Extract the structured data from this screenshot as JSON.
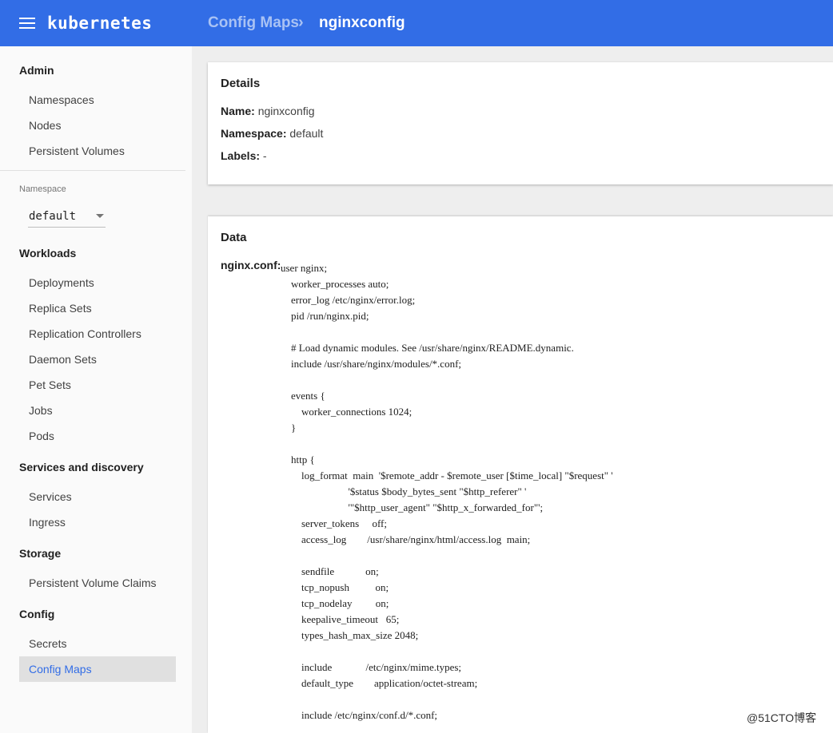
{
  "header": {
    "brand": "kubernetes",
    "breadcrumb_parent": "Config Maps",
    "breadcrumb_separator": "›",
    "breadcrumb_current": "nginxconfig"
  },
  "sidebar": {
    "admin_label": "Admin",
    "admin_items": [
      "Namespaces",
      "Nodes",
      "Persistent Volumes"
    ],
    "namespace_label": "Namespace",
    "namespace_value": "default",
    "workloads_label": "Workloads",
    "workload_items": [
      "Deployments",
      "Replica Sets",
      "Replication Controllers",
      "Daemon Sets",
      "Pet Sets",
      "Jobs",
      "Pods"
    ],
    "services_label": "Services and discovery",
    "service_items": [
      "Services",
      "Ingress"
    ],
    "storage_label": "Storage",
    "storage_items": [
      "Persistent Volume Claims"
    ],
    "config_label": "Config",
    "config_items": [
      "Secrets",
      "Config Maps"
    ],
    "active_item": "Config Maps"
  },
  "details": {
    "title": "Details",
    "name_label": "Name:",
    "name_value": "nginxconfig",
    "namespace_label": "Namespace:",
    "namespace_value": "default",
    "labels_label": "Labels:",
    "labels_value": "-"
  },
  "data": {
    "title": "Data",
    "key": "nginx.conf:",
    "value": "user nginx;\n    worker_processes auto;\n    error_log /etc/nginx/error.log;\n    pid /run/nginx.pid;\n\n    # Load dynamic modules. See /usr/share/nginx/README.dynamic.\n    include /usr/share/nginx/modules/*.conf;\n\n    events {\n        worker_connections 1024;\n    }\n\n    http {\n        log_format  main  '$remote_addr - $remote_user [$time_local] \"$request\" '\n                          '$status $body_bytes_sent \"$http_referer\" '\n                          '\"$http_user_agent\" \"$http_x_forwarded_for\"';\n        server_tokens     off;\n        access_log        /usr/share/nginx/html/access.log  main;\n\n        sendfile            on;\n        tcp_nopush          on;\n        tcp_nodelay         on;\n        keepalive_timeout   65;\n        types_hash_max_size 2048;\n\n        include             /etc/nginx/mime.types;\n        default_type        application/octet-stream;\n\n        include /etc/nginx/conf.d/*.conf;"
  },
  "watermark": "@51CTO博客",
  "colors": {
    "topbar": "#326de6",
    "active_text": "#326de6",
    "active_bg": "#e0e0e0",
    "sidebar_bg": "#fafafa",
    "page_bg": "#eeeeee"
  }
}
